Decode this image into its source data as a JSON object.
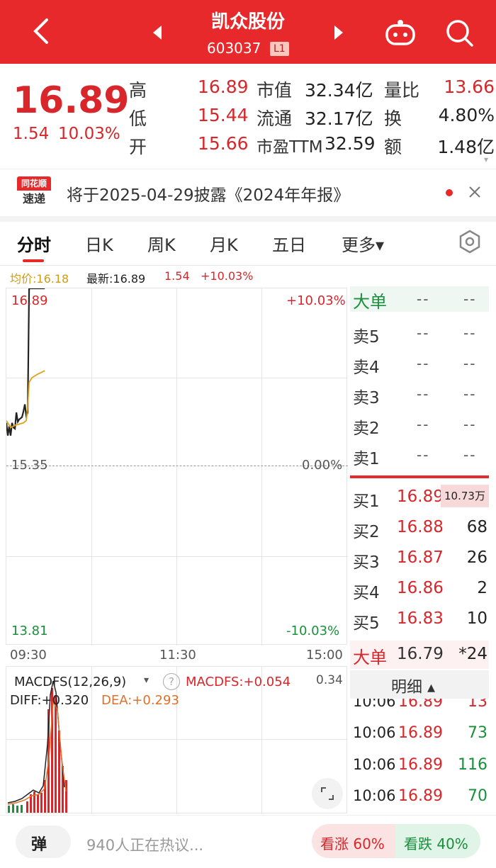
{
  "header": {
    "title": "凯众股份",
    "code": "603037",
    "level": "L1"
  },
  "quote": {
    "price": "16.89",
    "change": "1.54",
    "change_pct": "10.03%",
    "high_label": "高",
    "high": "16.89",
    "low_label": "低",
    "low": "15.44",
    "open_label": "开",
    "open": "15.66",
    "mktcap_label": "市值",
    "mktcap": "32.34亿",
    "float_label": "流通",
    "float": "32.17亿",
    "pe_label": "市盈TTM",
    "pe": "32.59",
    "vol_ratio_label": "量比",
    "vol_ratio": "13.66",
    "turnover_label": "换",
    "turnover": "4.80%",
    "amount_label": "额",
    "amount": "1.48亿"
  },
  "notice": {
    "badge_top": "同花顺",
    "badge_bottom": "速递",
    "text": "将于2025-04-29披露《2024年年报》"
  },
  "tabs": [
    {
      "label": "分时"
    },
    {
      "label": "日K"
    },
    {
      "label": "周K"
    },
    {
      "label": "月K"
    },
    {
      "label": "五日"
    },
    {
      "label": "更多▾"
    }
  ],
  "chart_info": {
    "avg_label": "均价:16.18",
    "latest_label": "最新:16.89",
    "latest_change": "1.54",
    "latest_pct": "+10.03%"
  },
  "chart_labels": {
    "top_price": "16.89",
    "top_pct": "+10.03%",
    "mid_price": "15.35",
    "mid_pct": "0.00%",
    "bottom_price": "13.81",
    "bottom_pct": "-10.03%",
    "t_start": "09:30",
    "t_mid": "11:30",
    "t_end": "15:00"
  },
  "chart_data": {
    "type": "line",
    "ylim": [
      13.81,
      16.89
    ],
    "prev_close": 15.35,
    "xlim_minutes": [
      0,
      240
    ],
    "series": [
      {
        "name": "最新",
        "points": [
          [
            0,
            15.73
          ],
          [
            1,
            15.62
          ],
          [
            2,
            15.7
          ],
          [
            3,
            15.62
          ],
          [
            4,
            15.73
          ],
          [
            5,
            15.69
          ],
          [
            6,
            15.68
          ],
          [
            7,
            15.82
          ],
          [
            8,
            15.74
          ],
          [
            9,
            15.76
          ],
          [
            10,
            15.77
          ],
          [
            11,
            15.78
          ],
          [
            12,
            15.83
          ],
          [
            13,
            15.89
          ],
          [
            14,
            15.79
          ],
          [
            15,
            15.82
          ],
          [
            16,
            16.89
          ],
          [
            17,
            16.89
          ],
          [
            18,
            16.89
          ],
          [
            20,
            16.89
          ],
          [
            25,
            16.89
          ],
          [
            27,
            16.89
          ]
        ]
      },
      {
        "name": "均价",
        "points": [
          [
            0,
            15.75
          ],
          [
            3,
            15.69
          ],
          [
            6,
            15.71
          ],
          [
            9,
            15.72
          ],
          [
            12,
            15.73
          ],
          [
            14,
            15.75
          ],
          [
            15,
            15.86
          ],
          [
            16,
            16.08
          ],
          [
            18,
            16.12
          ],
          [
            22,
            16.15
          ],
          [
            27,
            16.18
          ]
        ]
      }
    ]
  },
  "orderbook": {
    "big_label": "大单",
    "big_a": "--",
    "big_b": "--",
    "asks": [
      {
        "label": "卖5",
        "price": "--",
        "vol": "--"
      },
      {
        "label": "卖4",
        "price": "--",
        "vol": "--"
      },
      {
        "label": "卖3",
        "price": "--",
        "vol": "--"
      },
      {
        "label": "卖2",
        "price": "--",
        "vol": "--"
      },
      {
        "label": "卖1",
        "price": "--",
        "vol": "--"
      }
    ],
    "bids": [
      {
        "label": "买1",
        "price": "16.89",
        "vol": "10.73万"
      },
      {
        "label": "买2",
        "price": "16.88",
        "vol": "68"
      },
      {
        "label": "买3",
        "price": "16.87",
        "vol": "26"
      },
      {
        "label": "买4",
        "price": "16.86",
        "vol": "2"
      },
      {
        "label": "买5",
        "price": "16.83",
        "vol": "10"
      }
    ],
    "big2_label": "大单",
    "big2_price": "16.79",
    "big2_vol": "*24",
    "detail_label": "明细 ▴"
  },
  "ticks": [
    {
      "time": "10:06",
      "price": "16.89",
      "vol": "13"
    },
    {
      "time": "10:06",
      "price": "16.89",
      "vol": "73"
    },
    {
      "time": "10:06",
      "price": "16.89",
      "vol": "116"
    },
    {
      "time": "10:06",
      "price": "16.89",
      "vol": "70"
    }
  ],
  "macd": {
    "name": "MACDFS(12,26,9)",
    "value": "MACDFS:+0.054",
    "diff": "DIFF:+0.320",
    "dea": "DEA:+0.293",
    "scale": "0.34"
  },
  "footer": {
    "danmu_label": "弹",
    "discuss": "940人正在热议...",
    "up": "看涨 60%",
    "down": "看跌 40%"
  },
  "colors": {
    "brand": "#e8292b",
    "up": "#d8262a",
    "down": "#1a8f3c",
    "avg_line": "#e0a21a"
  }
}
